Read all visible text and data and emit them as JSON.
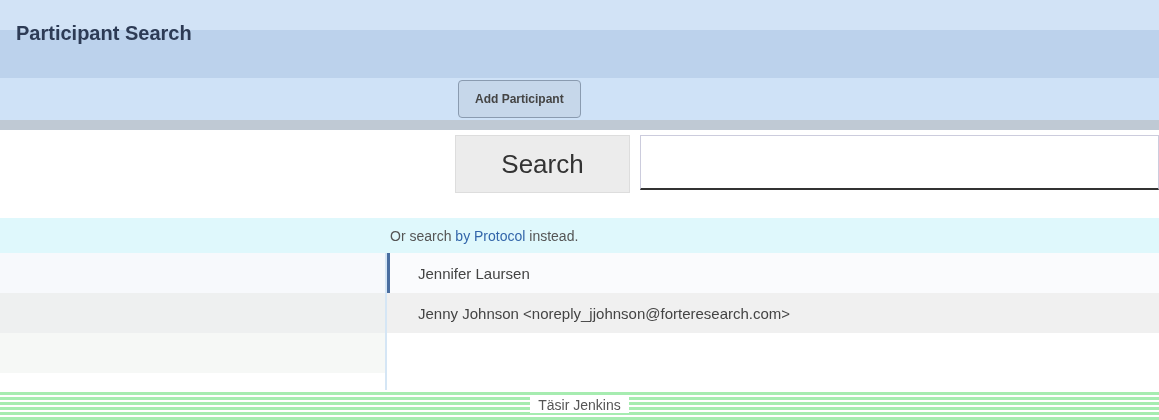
{
  "header": {
    "title": "Participant Search"
  },
  "toolbar": {
    "button": "Add Participant"
  },
  "search": {
    "button": "Search"
  },
  "hint": {
    "before": "Or search",
    "link": "by Protocol",
    "after": "instead."
  },
  "suggestions": [
    {
      "label": "Jennifer Laursen",
      "selected": true
    },
    {
      "label": "Jenny Johnson <noreply_jjohnson@forteresearch.com>",
      "selected": false
    }
  ],
  "footer": {
    "name": "Täsir Jenkins"
  }
}
